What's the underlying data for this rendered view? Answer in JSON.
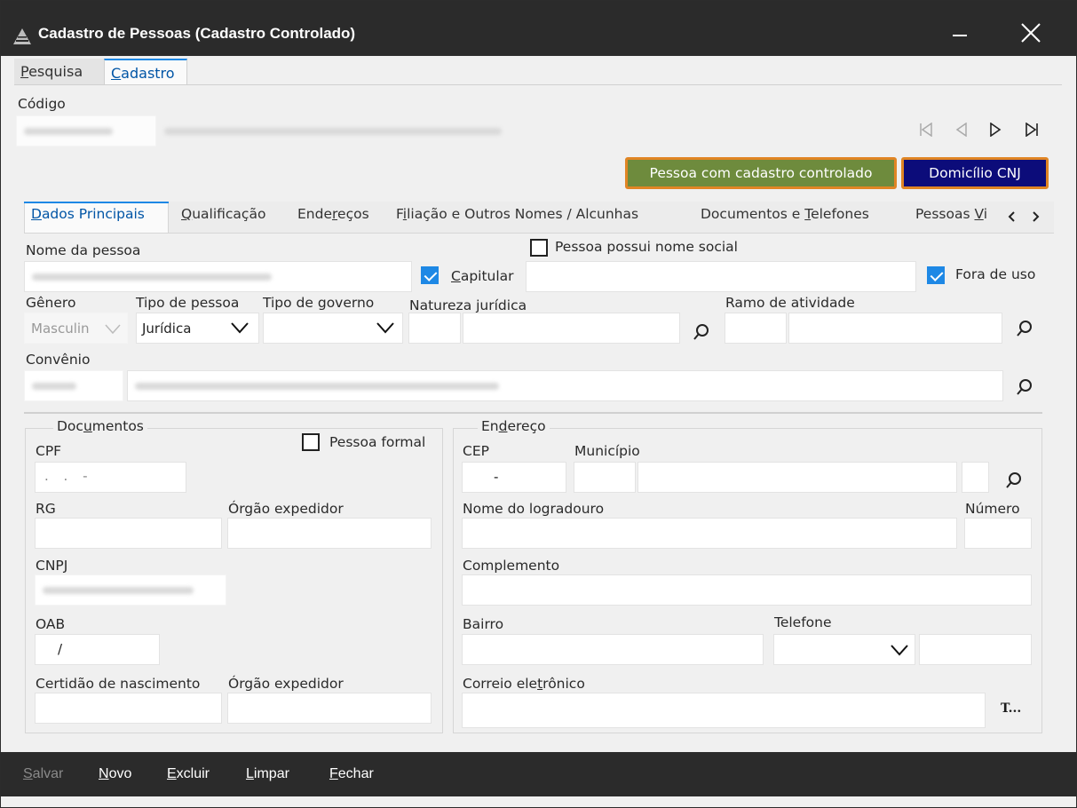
{
  "window": {
    "title": "Cadastro de Pessoas (Cadastro Controlado)"
  },
  "top_tabs": [
    {
      "label": "Pesquisa",
      "active": false
    },
    {
      "label": "Cadastro",
      "active": true
    }
  ],
  "codigo": {
    "label": "Código",
    "value": "",
    "name_value": ""
  },
  "buttons": {
    "pessoa_controlada": "Pessoa com cadastro controlado",
    "domicilio_cnj": "Domicílio CNJ"
  },
  "sub_tabs": [
    {
      "label": "Dados Principais",
      "active": true
    },
    {
      "label": "Qualificação",
      "active": false
    },
    {
      "label": "Endereços",
      "active": false
    },
    {
      "label": "Filiação e Outros Nomes / Alcunhas",
      "active": false
    },
    {
      "label": "Documentos e Telefones",
      "active": false
    },
    {
      "label": "Pessoas Vi",
      "active": false
    }
  ],
  "form": {
    "nome_label": "Nome da pessoa",
    "nome_value": "",
    "nome_social_label": "Pessoa possui nome social",
    "capitular_label": "Capitular",
    "fora_uso_label": "Fora de uso",
    "genero_label": "Gênero",
    "genero_value": "Masculin",
    "tipo_pessoa_label": "Tipo de pessoa",
    "tipo_pessoa_value": "Jurídica",
    "tipo_governo_label": "Tipo de governo",
    "tipo_governo_value": "",
    "natureza_label": "Natureza jurídica",
    "ramo_label": "Ramo de atividade",
    "convenio_label": "Convênio",
    "convenio_code": "",
    "convenio_name": ""
  },
  "documentos": {
    "title": "Documentos",
    "pessoa_formal_label": "Pessoa formal",
    "cpf_label": "CPF",
    "cpf_value": ". . -",
    "rg_label": "RG",
    "orgao_label": "Órgão expedidor",
    "cnpj_label": "CNPJ",
    "cnpj_value": "",
    "oab_label": "OAB",
    "oab_value": "/",
    "certidao_label": "Certidão de nascimento",
    "orgao2_label": "Órgão expedidor"
  },
  "endereco": {
    "title": "Endereço",
    "cep_label": "CEP",
    "cep_value": "-",
    "municipio_label": "Município",
    "logradouro_label": "Nome do logradouro",
    "numero_label": "Número",
    "complemento_label": "Complemento",
    "bairro_label": "Bairro",
    "telefone_label": "Telefone",
    "email_label": "Correio eletrônico",
    "email_button": "T..."
  },
  "bottom_bar": {
    "salvar": "Salvar",
    "novo": "Novo",
    "excluir": "Excluir",
    "limpar": "Limpar",
    "fechar": "Fechar"
  },
  "colors": {
    "titlebar": "#2b2b2b",
    "accent_blue": "#1e88e5",
    "highlight_orange": "#e08524",
    "controlado_bg": "#6e8b3d",
    "cnj_bg": "#0c0c7a"
  },
  "icons": [
    "app-logo-icon",
    "minimize-icon",
    "close-icon",
    "first-record-icon",
    "previous-record-icon",
    "next-record-icon",
    "last-record-icon",
    "search-icon",
    "chevron-down-icon",
    "checkmark-icon"
  ]
}
